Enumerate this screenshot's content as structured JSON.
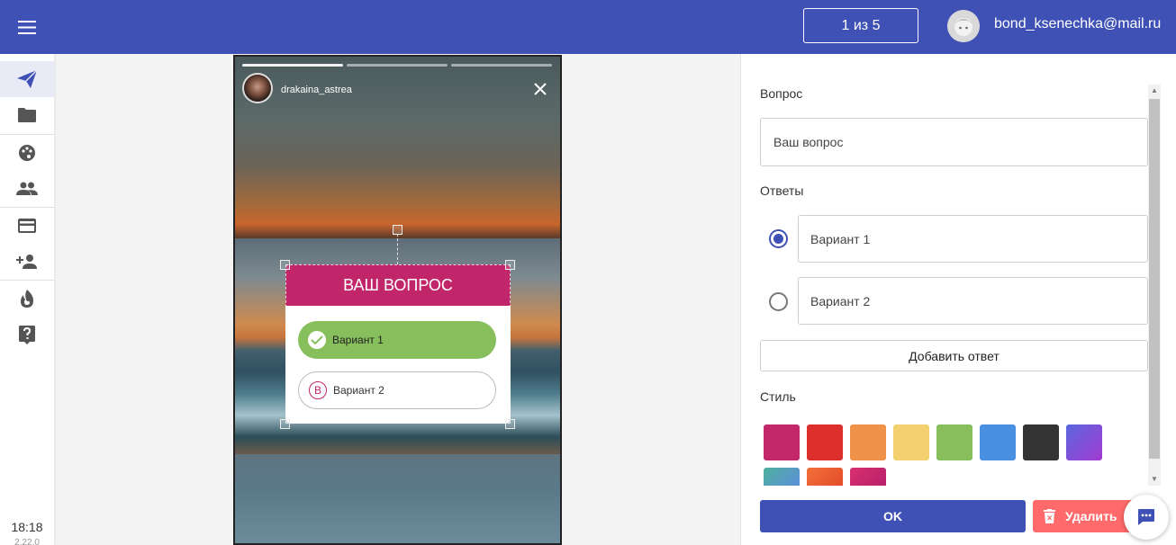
{
  "header": {
    "story_counter": "1 из 5",
    "user_email": "bond_ksenechka@mail.ru"
  },
  "sidebar": {
    "items": [
      {
        "name": "send-icon",
        "active": true
      },
      {
        "name": "folder-icon"
      },
      {
        "name": "palette-icon"
      },
      {
        "name": "people-icon"
      },
      {
        "name": "credit-card-icon"
      },
      {
        "name": "add-user-icon"
      },
      {
        "name": "fire-icon"
      },
      {
        "name": "help-icon"
      }
    ],
    "time": "18:18",
    "version": "2.22.0"
  },
  "story": {
    "username": "drakaina_astrea",
    "progress_segments": 3,
    "poll": {
      "question": "ВАШ ВОПРОС",
      "options": [
        {
          "label": "Вариант 1",
          "badge": "✓"
        },
        {
          "label": "Вариант 2",
          "badge": "В"
        }
      ]
    }
  },
  "panel": {
    "question_label": "Вопрос",
    "question_value": "Ваш вопрос",
    "answers_label": "Ответы",
    "answers": [
      {
        "value": "Вариант 1",
        "selected": true
      },
      {
        "value": "Вариант 2",
        "selected": false
      }
    ],
    "add_answer": "Добавить ответ",
    "style_label": "Стиль",
    "swatches": [
      "#c2286a",
      "#dc2f2c",
      "#ef924a",
      "#f3d06d",
      "#86bf5c",
      "#4a90e2",
      "#333333",
      "gradient-purple",
      "gradient-teal",
      "gradient-orange",
      "gradient-pink"
    ],
    "ok": "OK",
    "delete": "Удалить"
  },
  "colors": {
    "primary": "#3f51b5",
    "accent": "#c2266a",
    "danger": "#ff6b6b"
  }
}
